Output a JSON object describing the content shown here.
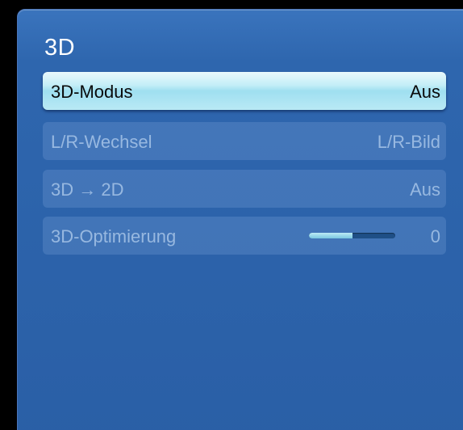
{
  "menu": {
    "title": "3D",
    "items": [
      {
        "label": "3D-Modus",
        "value": "Aus",
        "selected": true,
        "enabled": true
      },
      {
        "label": "L/R-Wechsel",
        "value": "L/R-Bild",
        "selected": false,
        "enabled": false
      },
      {
        "label": "3D → 2D",
        "value": "Aus",
        "selected": false,
        "enabled": false
      },
      {
        "label": "3D-Optimierung",
        "value": "0",
        "selected": false,
        "enabled": false,
        "slider_level": 0.5
      }
    ]
  },
  "colors": {
    "panel_background": "#2e66ae",
    "selected_highlight": "#b9e9f5",
    "disabled_text": "#b9d2f0",
    "slider_fill": "#79c8e0"
  }
}
